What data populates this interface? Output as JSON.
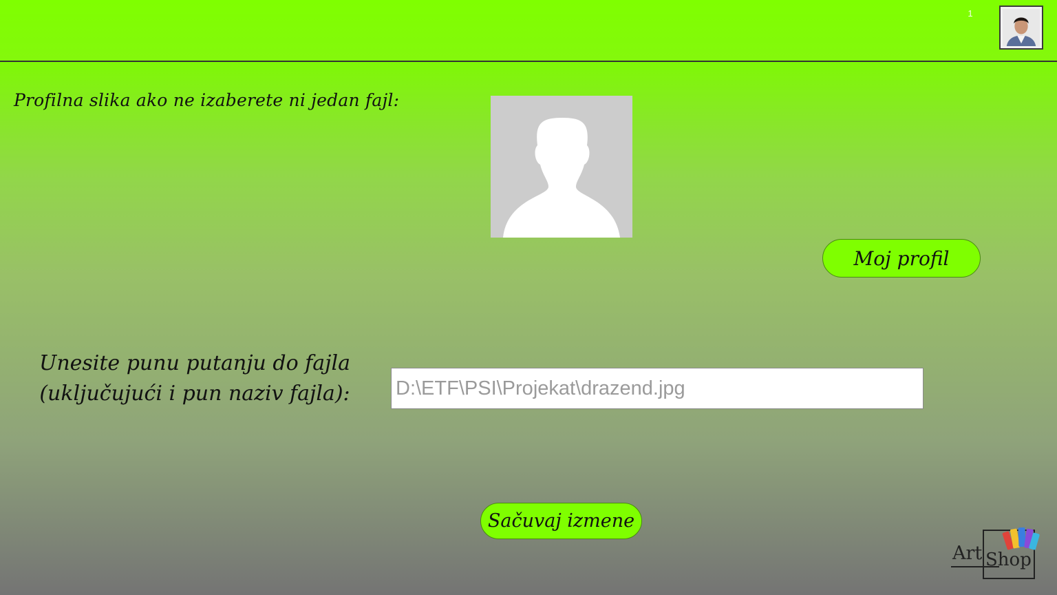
{
  "header": {
    "notification_count": "1",
    "avatar_icon": "user-photo-icon"
  },
  "default_picture": {
    "label": "Profilna slika ako ne izaberete ni jedan fajl:",
    "icon": "default-avatar-icon"
  },
  "buttons": {
    "my_profile": "Moj profil",
    "save_changes": "Sačuvaj izmene"
  },
  "path_form": {
    "label_line1": "Unesite punu putanju do fajla",
    "label_line2": "(uključujući i pun naziv fajla):",
    "input_value": "D:\\ETF\\PSI\\Projekat\\drazend.jpg"
  },
  "logo": {
    "word1": "Art",
    "word2": "Shop"
  },
  "colors": {
    "accent": "#7fff00",
    "header_border": "#333333",
    "placeholder_bg": "#cccccc"
  }
}
